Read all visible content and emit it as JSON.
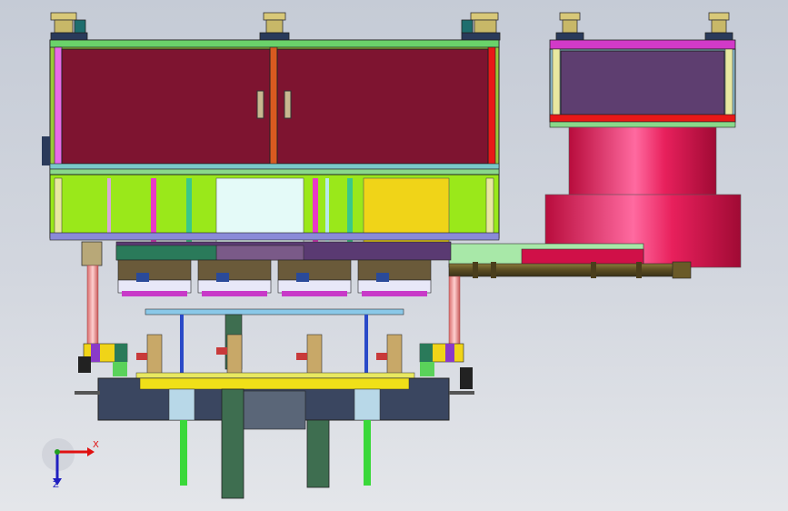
{
  "axis_triad": {
    "x_label": "X",
    "z_label": "Z"
  },
  "colors": {
    "background": "#cdd2db",
    "cabinet_door": "#7e1430",
    "lime_panel": "#9ae81a",
    "green_frame": "#5ad25a",
    "magenta_frame": "#d22ad2",
    "red_bar": "#e81818",
    "yellow_panel": "#f0d418",
    "cyan_panel": "#e4faf8",
    "purple_panel": "#5e3e70",
    "cylinder_pink": "#e0104a",
    "base_navy": "#3a4660",
    "column_green": "#3e6e50"
  }
}
